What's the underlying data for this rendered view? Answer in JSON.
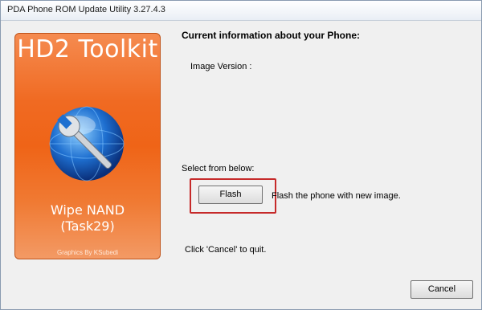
{
  "window": {
    "title": "PDA Phone ROM Update Utility 3.27.4.3"
  },
  "banner": {
    "title": "HD2 Toolkit",
    "line1": "Wipe NAND",
    "line2": "(Task29)",
    "credit": "Graphics By KSubedi",
    "graphic": "globe-wrench-icon"
  },
  "info": {
    "heading": "Current information about your Phone:",
    "image_version_label": "Image Version :"
  },
  "select": {
    "label": "Select from below:",
    "flash_button": "Flash",
    "flash_desc": "Flash the phone with new image."
  },
  "footer": {
    "quit_text": "Click 'Cancel' to quit.",
    "cancel_button": "Cancel"
  },
  "colors": {
    "banner_orange": "#ef6417",
    "highlight_red": "#c62a2a"
  }
}
